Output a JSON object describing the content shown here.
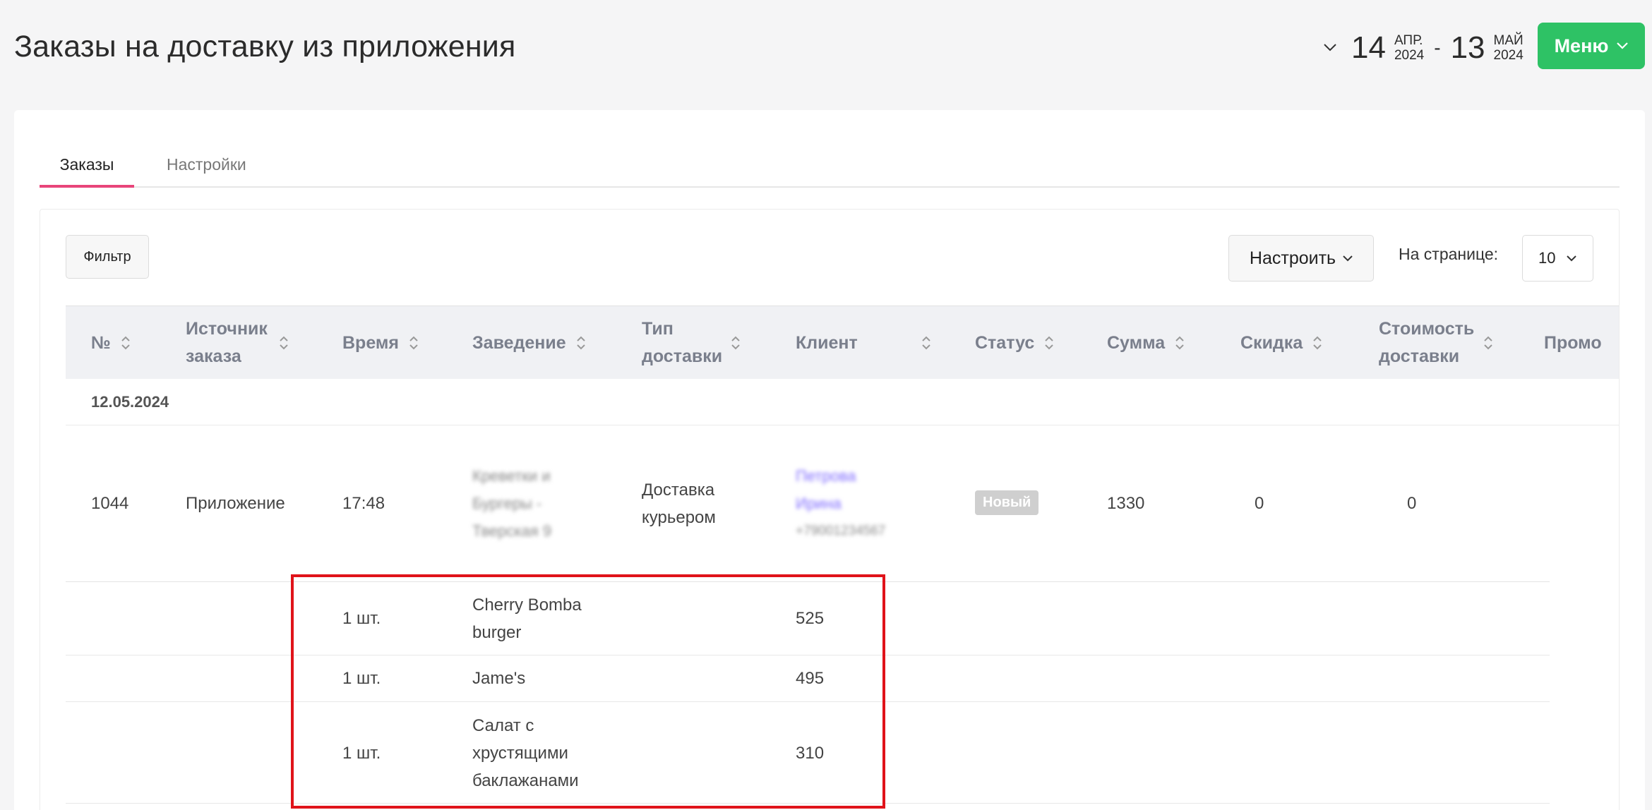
{
  "header": {
    "title": "Заказы на доставку из приложения",
    "date_from": {
      "day": "14",
      "month": "АПР.",
      "year": "2024"
    },
    "date_to": {
      "day": "13",
      "month": "МАЙ",
      "year": "2024"
    },
    "date_separator": "-",
    "menu_label": "Меню"
  },
  "tabs": [
    {
      "label": "Заказы",
      "active": true
    },
    {
      "label": "Настройки",
      "active": false
    }
  ],
  "toolbar": {
    "filter_label": "Фильтр",
    "configure_label": "Настроить",
    "per_page_label": "На странице:",
    "per_page_value": "10"
  },
  "table": {
    "columns": [
      {
        "label": "№"
      },
      {
        "label": "Источник заказа"
      },
      {
        "label": "Время"
      },
      {
        "label": "Заведение"
      },
      {
        "label": "Тип доставки"
      },
      {
        "label": "Клиент"
      },
      {
        "label": "Статус"
      },
      {
        "label": "Сумма"
      },
      {
        "label": "Скидка"
      },
      {
        "label": "Стоимость доставки"
      },
      {
        "label": "Промо"
      }
    ],
    "date_group": "12.05.2024",
    "order": {
      "number": "1044",
      "source": "Приложение",
      "time": "17:48",
      "venue_blurred": "Креветки и Бургеры - Тверская 9",
      "delivery_type": "Доставка курьером",
      "client_name_blurred": "Петрова Ирина",
      "client_phone_blurred": "+79001234567",
      "status": "Новый",
      "sum": "1330",
      "discount": "0",
      "delivery_cost": "0"
    },
    "items": [
      {
        "qty": "1 шт.",
        "name": "Cherry Bomba burger",
        "price": "525"
      },
      {
        "qty": "1 шт.",
        "name": "Jame's",
        "price": "495"
      },
      {
        "qty": "1 шт.",
        "name": "Салат с хрустящими баклажанами",
        "price": "310"
      }
    ]
  },
  "colors": {
    "accent_green": "#2ec265",
    "tab_underline": "#e8457a",
    "highlight": "#e0131a",
    "status_badge": "#cfcfcf"
  }
}
